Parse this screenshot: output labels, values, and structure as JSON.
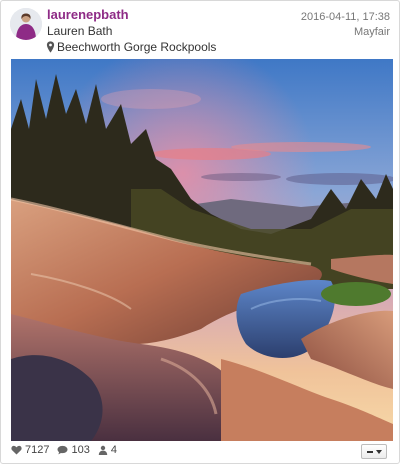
{
  "post": {
    "username": "laurenepbath",
    "full_name": "Lauren Bath",
    "location": "Beechworth Gorge Rockpools",
    "timestamp": "2016-04-11, 17:38",
    "city": "Mayfair"
  },
  "stats": {
    "likes": "7127",
    "comments": "103",
    "users": "4"
  },
  "icons": {
    "location": "map-pin-icon",
    "likes": "heart-icon",
    "comments": "comment-icon",
    "users": "users-icon",
    "menu": "menu-dropdown-icon"
  },
  "colors": {
    "username": "#8e2b86",
    "text": "#333333",
    "muted": "#777777"
  }
}
